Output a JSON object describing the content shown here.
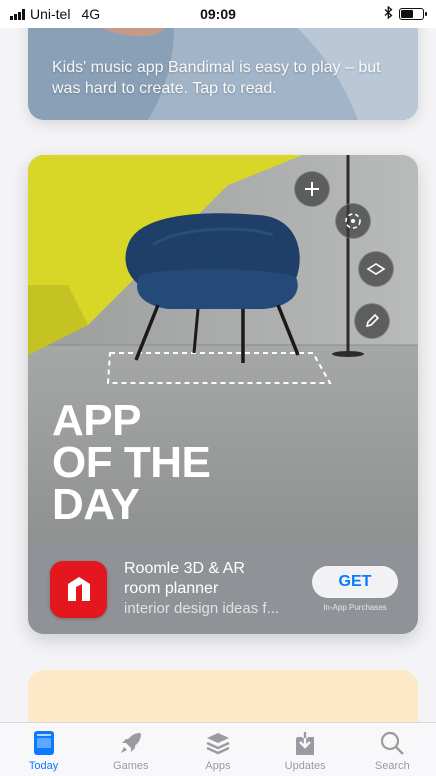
{
  "status_bar": {
    "carrier": "Uni-tel",
    "network": "4G",
    "time": "09:09",
    "bluetooth_icon": "bluetooth-icon",
    "battery_level": 0.55
  },
  "story_card": {
    "caption": "Kids' music app Bandimal is easy to play – but was hard to create. Tap to read."
  },
  "app_of_the_day": {
    "title_lines": [
      "APP",
      "OF THE",
      "DAY"
    ],
    "ar_controls": [
      "plus-icon",
      "rotate-icon",
      "surface-icon",
      "pencil-icon"
    ],
    "app": {
      "name_line1": "Roomle 3D & AR",
      "name_line2": "room planner",
      "subtitle": "interior design ideas f...",
      "get_label": "GET",
      "iap_note": "In-App Purchases",
      "icon_color": "#e3171d"
    }
  },
  "tab_bar": {
    "tabs": [
      {
        "label": "Today",
        "icon": "today-icon",
        "active": true
      },
      {
        "label": "Games",
        "icon": "rocket-icon",
        "active": false
      },
      {
        "label": "Apps",
        "icon": "layers-icon",
        "active": false
      },
      {
        "label": "Updates",
        "icon": "download-icon",
        "active": false
      },
      {
        "label": "Search",
        "icon": "search-icon",
        "active": false
      }
    ]
  },
  "colors": {
    "accent": "#0a7aff",
    "inactive_tab": "#9a9aa0",
    "next_card": "#fde9c8"
  }
}
